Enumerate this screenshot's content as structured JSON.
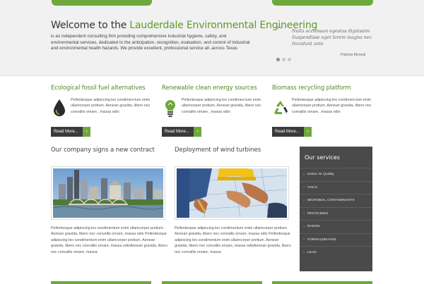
{
  "hero": {
    "welcome_prefix": "Welcome to the ",
    "welcome_name": "Lauderdale Environmental Engineering",
    "intro": "is an independent consulting firm providing comprehensive industrial hygiene, safety, and environmental services, dedicated to the anticipation, recognition, evaluation, and control of industrial and environmental health hazards. We provide excellent, professional service all .across Texas",
    "quote": "Nulla accumsan egestas dignissim Suspendisse eget lorem magna nec tincidunt ante",
    "quote_author": "Patricia Mcneal",
    "slider_dots": 3,
    "active_dot": 0
  },
  "features": [
    {
      "title": "Ecological fossil fuel alternatives",
      "icon": "oil-drop-icon",
      "text": "Pellentesque adipiscing leo condimen-tum enim ullamcorper pretium. Aenean gravida, libero nec convallis ornare, .massa odio",
      "button": "Read More...",
      "arrow": "›"
    },
    {
      "title": "Renewable clean energy sources",
      "icon": "light-bulb-icon",
      "text": "Pellentesque adipiscing leo condimen-tum enim ullamcorper pretium. Aenean gravida, libero nec convallis ornare, .massa odio",
      "button": "Read More...",
      "arrow": "›"
    },
    {
      "title": "Biomass recycling platform",
      "icon": "recycle-icon",
      "text": "Pellentesque adipiscing leo condimen-tum enim ullamcorper pretium. Aenean gravida, libero nec convallis ornare, .massa odio",
      "button": "Read More...",
      "arrow": "›"
    }
  ],
  "news": [
    {
      "title": "Our company signs a new contract",
      "image": "city-skyline-photo",
      "text": "Pellentesque adipiscing leo condimentum enim ullamcorper pretium. Aenean gravida, libero nec convallis ornare, massa odio Pellentesque adipiscing leo condimentum enim ullamcorper pretium. Aenean gravida, libero nec convallis ornare, massa odioAenean gravida, libero nec convallis ornare, massa"
    },
    {
      "title": "Deployment of wind turbines",
      "image": "engineers-blueprint-photo",
      "text": "Pellentesque adipiscing leo condimentum enim ullamcorper pretium. Aenean gravida, libero nec convallis ornare, massa odio Pellentesque adipiscing leo condimentum enim ullamcorper pretium. Aenean gravida, libero nec convallis ornare, massa odioAenean gravida, libero nec convallis ornare, massa"
    }
  ],
  "services": {
    "title": "Our services",
    "chevron": "›",
    "items": [
      "Indoor Air Quality",
      "VOC's",
      "MICROBIAL CONTAMINANTS",
      "PESTICIDES",
      "RADON",
      "FORMALDEHYDE",
      "LEAD"
    ]
  },
  "colors": {
    "accent": "#6ea83b",
    "dark": "#4a4a4a",
    "title_green": "#4f8a25"
  }
}
